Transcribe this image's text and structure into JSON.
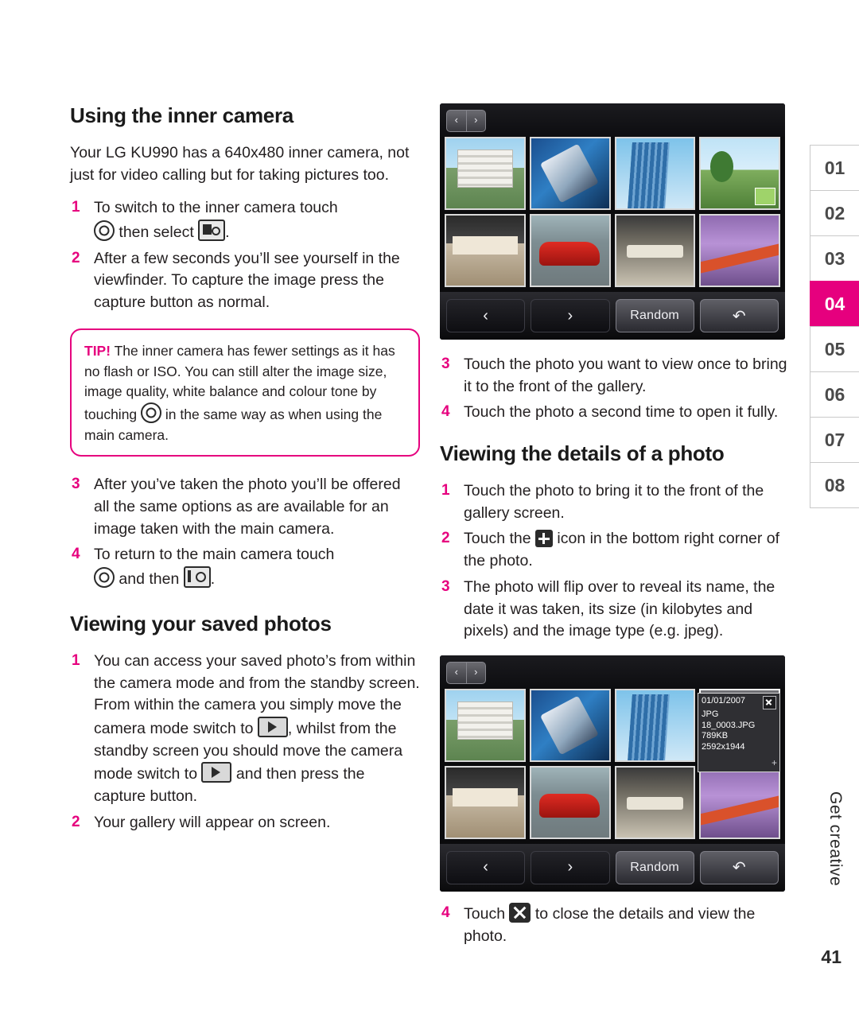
{
  "left_column": {
    "title": "Using the inner camera",
    "intro": "Your LG KU990 has a 640x480 inner camera, not just for video calling but for taking pictures too.",
    "steps": [
      {
        "num": "1",
        "text_a": "To switch to the inner camera touch",
        "text_b": "then select",
        "text_c": "."
      },
      {
        "num": "2",
        "text": "After a few seconds you’ll see yourself in the viewfinder. To capture the image press the capture button as normal."
      }
    ],
    "tip": {
      "label": "TIP!",
      "text_a": "The inner camera has fewer settings as it has no flash or ISO. You can still alter the image size, image quality, white balance and colour tone by touching",
      "text_b": "in the same way as when using the main camera."
    },
    "steps2": [
      {
        "num": "3",
        "text": "After you’ve taken the photo you’ll be offered all the same options as are available for an image taken with the main camera."
      },
      {
        "num": "4",
        "text_a": "To return to the main camera touch",
        "text_b": "and then",
        "text_c": "."
      }
    ],
    "title2": "Viewing your saved photos",
    "steps3": [
      {
        "num": "1",
        "text_a": "You can access your saved photo’s from within the camera mode and from the standby screen. From within the camera you simply move the camera mode switch to",
        "text_b": ", whilst from the standby screen you should move the camera mode switch to",
        "text_c": "and then press the capture button."
      },
      {
        "num": "2",
        "text": "Your gallery will appear on screen."
      }
    ]
  },
  "right_column": {
    "gallery_steps": [
      {
        "num": "3",
        "text": "Touch the photo you want to view once to bring it to the front of the gallery."
      },
      {
        "num": "4",
        "text": "Touch the photo a second time to open it fully."
      }
    ],
    "title": "Viewing the details of a photo",
    "detail_steps": [
      {
        "num": "1",
        "text": "Touch the photo to bring it to the front of the gallery screen."
      },
      {
        "num": "2",
        "text_a": "Touch the",
        "text_b": "icon in the bottom right corner of the photo."
      },
      {
        "num": "3",
        "text": "The photo will flip over to reveal its name, the date it was taken, its size (in kilobytes and pixels) and the image type (e.g. jpeg)."
      }
    ],
    "final_step": {
      "num": "4",
      "text_a": "Touch",
      "text_b": "to close the details and view the photo."
    }
  },
  "screenshot1": {
    "nav_left": "‹",
    "nav_right": "›",
    "buttons": {
      "back_arrow": "‹",
      "forward_arrow": "›",
      "random": "Random",
      "return": "↶"
    },
    "thumbs": [
      "photo-building",
      "photo-phone",
      "photo-tower",
      "photo-tree",
      "photo-kitchen",
      "photo-car",
      "photo-dining",
      "photo-blossom"
    ]
  },
  "screenshot2": {
    "nav_left": "‹",
    "nav_right": "›",
    "buttons": {
      "back_arrow": "‹",
      "forward_arrow": "›",
      "random": "Random",
      "return": "↶"
    },
    "detail_panel": {
      "date": "01/01/2007",
      "type": "JPG",
      "filename": "18_0003.JPG",
      "filesize": "789KB",
      "dimensions": "2592x1944",
      "expand": "+"
    }
  },
  "tabs": {
    "items": [
      "01",
      "02",
      "03",
      "04",
      "05",
      "06",
      "07",
      "08"
    ],
    "active": "04",
    "active_color": "#e6007e"
  },
  "footer": {
    "section_label": "Get creative",
    "page_number": "41"
  }
}
